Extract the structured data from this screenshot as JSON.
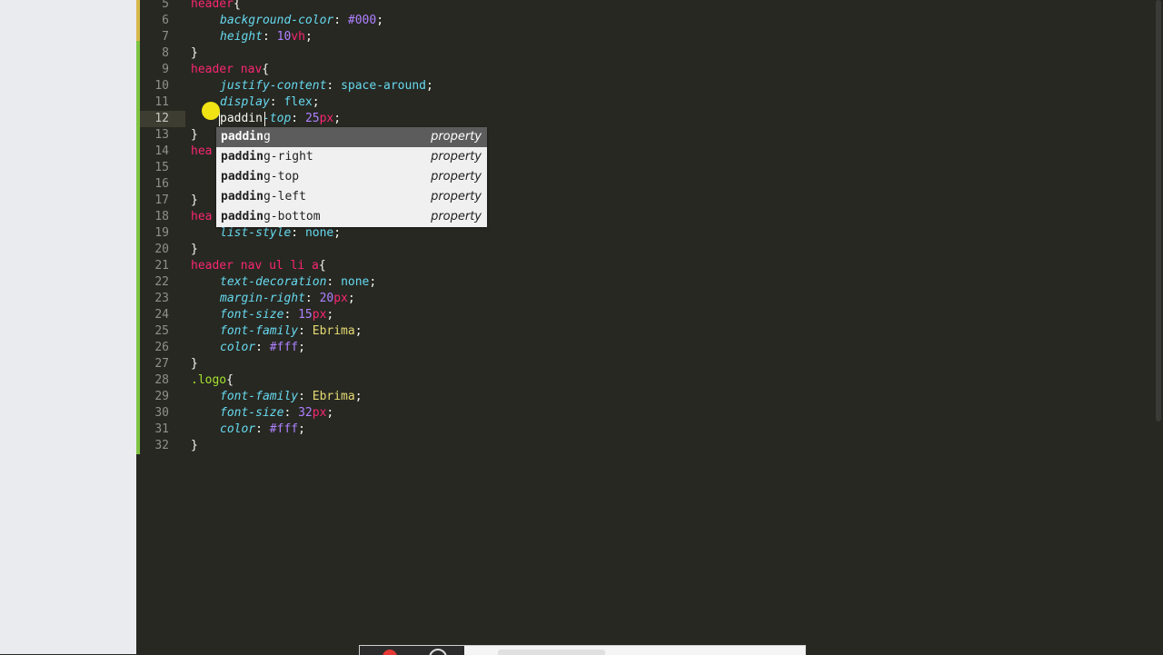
{
  "gutter": {
    "line_numbers": [
      "5",
      "6",
      "7",
      "8",
      "9",
      "10",
      "11",
      "12",
      "13",
      "14",
      "15",
      "16",
      "17",
      "18",
      "19",
      "20",
      "21",
      "22",
      "23",
      "24",
      "25",
      "26",
      "27",
      "28",
      "29",
      "30",
      "31",
      "32"
    ]
  },
  "code": {
    "l5": {
      "sel": "header",
      "brace": "{"
    },
    "l6": {
      "prop": "background-color",
      "colon": ": ",
      "val": "#000",
      "semi": ";"
    },
    "l7": {
      "prop": "height",
      "colon": ": ",
      "num": "10",
      "unit": "vh",
      "semi": ";"
    },
    "l8": {
      "close": "}"
    },
    "l9": {
      "sel": "header nav",
      "brace": "{"
    },
    "l10": {
      "prop": "justify-content",
      "colon": ": ",
      "val": "space-around",
      "semi": ";"
    },
    "l11": {
      "prop": "display",
      "colon": ": ",
      "val": "flex",
      "semi": ";"
    },
    "l12": {
      "typed": "paddin",
      "prop": "-top",
      "colon": ": ",
      "num": "25",
      "unit": "px",
      "semi": ";"
    },
    "l13": {
      "close": "}"
    },
    "l14": {
      "sel": "hea"
    },
    "l17": {
      "close": "}"
    },
    "l18": {
      "sel": "hea"
    },
    "l19": {
      "prop": "list-style",
      "colon": ": ",
      "val": "none",
      "semi": ";"
    },
    "l20": {
      "close": "}"
    },
    "l21": {
      "sel": "header nav ul li a",
      "brace": "{"
    },
    "l22": {
      "prop": "text-decoration",
      "colon": ": ",
      "val": "none",
      "semi": ";"
    },
    "l23": {
      "prop": "margin-right",
      "colon": ": ",
      "num": "20",
      "unit": "px",
      "semi": ";"
    },
    "l24": {
      "prop": "font-size",
      "colon": ": ",
      "num": "15",
      "unit": "px",
      "semi": ";"
    },
    "l25": {
      "prop": "font-family",
      "colon": ": ",
      "str": "Ebrima",
      "semi": ";"
    },
    "l26": {
      "prop": "color",
      "colon": ": ",
      "val": "#fff",
      "semi": ";"
    },
    "l27": {
      "close": "}"
    },
    "l28": {
      "cls": ".logo",
      "brace": "{"
    },
    "l29": {
      "prop": "font-family",
      "colon": ": ",
      "str": "Ebrima",
      "semi": ";"
    },
    "l30": {
      "prop": "font-size",
      "colon": ": ",
      "num": "32",
      "unit": "px",
      "semi": ";"
    },
    "l31": {
      "prop": "color",
      "colon": ": ",
      "val": "#fff",
      "semi": ";"
    },
    "l32": {
      "close": "}"
    }
  },
  "autocomplete": {
    "items": [
      {
        "match": "paddin",
        "rest": "g",
        "kind": "property"
      },
      {
        "match": "paddin",
        "rest": "g-right",
        "kind": "property"
      },
      {
        "match": "paddin",
        "rest": "g-top",
        "kind": "property"
      },
      {
        "match": "paddin",
        "rest": "g-left",
        "kind": "property"
      },
      {
        "match": "paddin",
        "rest": "g-bottom",
        "kind": "property"
      }
    ]
  },
  "colors": {
    "editor_bg": "#272822",
    "selector": "#f92672",
    "property": "#66d9ef",
    "number": "#ae81ff",
    "string": "#e6db74",
    "class": "#a6e22e",
    "cursor_highlight": "#f1e314",
    "modified_marker": "#7fc241"
  }
}
